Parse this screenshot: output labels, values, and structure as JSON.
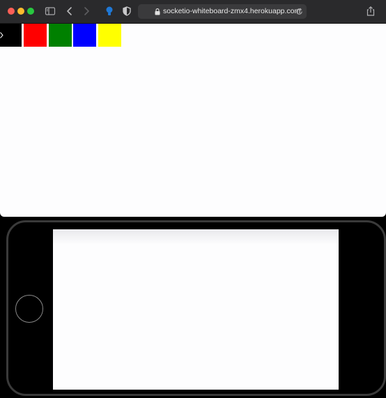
{
  "browser": {
    "url": "socketio-whiteboard-zmx4.herokuapp.com",
    "icons": [
      "close-window",
      "minimize-window",
      "zoom-window",
      "sidebar-icon",
      "back-icon",
      "forward-icon",
      "extension-icon",
      "shield-icon",
      "lock-icon",
      "reload-icon",
      "share-icon"
    ]
  },
  "palette": {
    "colors": [
      "#000000",
      "#ff0000",
      "#008000",
      "#0000ff",
      "#ffff00"
    ]
  },
  "phone": {
    "screen_background": "#fdfdfe"
  }
}
